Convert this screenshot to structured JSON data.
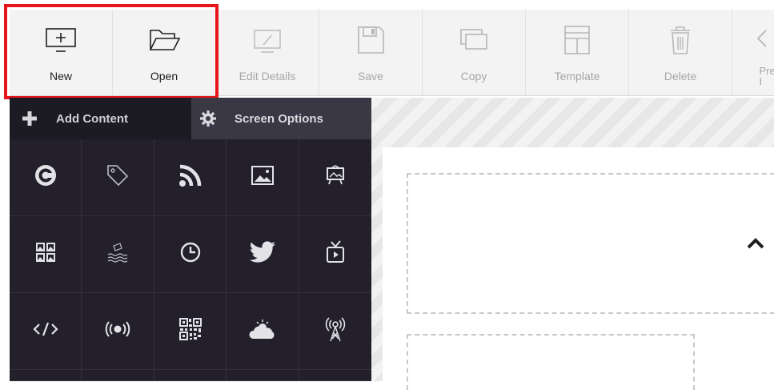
{
  "toolbar": {
    "buttons": [
      {
        "label": "New",
        "icon": "new-screen-icon",
        "enabled": true
      },
      {
        "label": "Open",
        "icon": "folder-open-icon",
        "enabled": true
      },
      {
        "label": "Edit Details",
        "icon": "edit-details-icon",
        "enabled": false
      },
      {
        "label": "Save",
        "icon": "save-icon",
        "enabled": false
      },
      {
        "label": "Copy",
        "icon": "copy-icon",
        "enabled": false
      },
      {
        "label": "Template",
        "icon": "template-icon",
        "enabled": false
      },
      {
        "label": "Delete",
        "icon": "trash-icon",
        "enabled": false
      },
      {
        "label": "Pre\nI",
        "icon": "preview-icon",
        "enabled": false
      }
    ],
    "highlight_color": "#e8161a"
  },
  "panel": {
    "tabs": [
      {
        "label": "Add Content",
        "icon": "plus-icon",
        "active": true
      },
      {
        "label": "Screen Options",
        "icon": "gear-icon",
        "active": false
      }
    ],
    "widgets": [
      "brand-c-icon",
      "tag-icon",
      "rss-icon",
      "image-icon",
      "slideshow-icon",
      "gallery-grid-icon",
      "ticker-wave-icon",
      "clock-icon",
      "twitter-icon",
      "tv-icon",
      "code-icon",
      "broadcast-icon",
      "qr-code-icon",
      "weather-icon",
      "antenna-icon"
    ],
    "background": "#23202b"
  },
  "canvas": {
    "collapse_icon": "chevron-up-icon"
  }
}
